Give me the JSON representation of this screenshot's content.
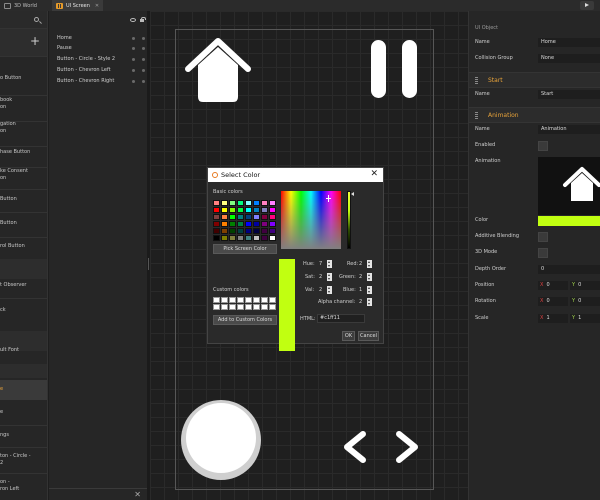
{
  "tabs": {
    "world_partial": "3D World",
    "ui_screen": "UI Screen"
  },
  "left_panel": {
    "items": [
      "o Button",
      "book\non",
      "gation\non",
      "hase Button",
      "ke Consent\non",
      "Button",
      "Button",
      "rol Button",
      "t Observer",
      "ck",
      "ult Font",
      "e",
      "e",
      "ngs",
      "ton - Circle -\n2",
      "on -\nron Left"
    ]
  },
  "hierarchy": {
    "items": [
      "Home",
      "Pause",
      "Button - Circle - Style 2",
      "Button - Chevron Left",
      "Button - Chevron Right"
    ]
  },
  "color_dialog": {
    "title": "Select Color",
    "basic_colors_label": "Basic colors",
    "custom_colors_label": "Custom colors",
    "pick_screen_label": "Pick Screen Color",
    "add_custom_label": "Add to Custom Colors",
    "hue_label": "Hue:",
    "hue": "7",
    "sat_label": "Sat:",
    "sat": "2",
    "val_label": "Val:",
    "val": "2",
    "red_label": "Red:",
    "red": "2",
    "green_label": "Green:",
    "green": "2",
    "blue_label": "Blue:",
    "blue": "1",
    "alpha_label": "Alpha channel:",
    "alpha": "2",
    "html_label": "HTML:",
    "html": "#c1ff11",
    "ok_label": "OK",
    "cancel_label": "Cancel",
    "selected_color": "#c1ff11",
    "basic_swatches": [
      "#ff8080",
      "#ffff80",
      "#80ff80",
      "#00ff80",
      "#80ffff",
      "#0080ff",
      "#ff80c0",
      "#ff80ff",
      "#ff0000",
      "#ffff00",
      "#80ff00",
      "#00ff40",
      "#00ffff",
      "#0080c0",
      "#8080c0",
      "#ff00ff",
      "#804040",
      "#ff8040",
      "#00ff00",
      "#008080",
      "#004080",
      "#8080ff",
      "#800040",
      "#ff0080",
      "#800000",
      "#ff8000",
      "#008000",
      "#008040",
      "#0000ff",
      "#0000a0",
      "#800080",
      "#8000ff",
      "#400000",
      "#804000",
      "#004000",
      "#004040",
      "#000080",
      "#000040",
      "#400040",
      "#400080",
      "#000000",
      "#808000",
      "#808040",
      "#808080",
      "#408080",
      "#c0c0c0",
      "#400040",
      "#ffffff"
    ]
  },
  "inspector": {
    "section_title": "UI Object",
    "name_label": "Name",
    "name_value": "Home",
    "collision_label": "Collision Group",
    "collision_value": "None",
    "start_section": "Start",
    "start_name_label": "Name",
    "start_name_value": "Start",
    "anim_section": "Animation",
    "anim_name_label": "Name",
    "anim_name_value": "Animation",
    "enabled_label": "Enabled",
    "animation_label": "Animation",
    "color_label": "Color",
    "color_value": "#c1ff11",
    "additive_label": "Additive Blending",
    "mode3d_label": "3D Mode",
    "depth_label": "Depth Order",
    "depth_value": "0",
    "position_label": "Position",
    "pos_x": "0",
    "pos_y": "0",
    "rotation_label": "Rotation",
    "rot_x": "0",
    "rot_y": "0",
    "scale_label": "Scale",
    "scale_x": "1",
    "scale_y": "1",
    "axis_x": "X",
    "axis_y": "Y"
  }
}
